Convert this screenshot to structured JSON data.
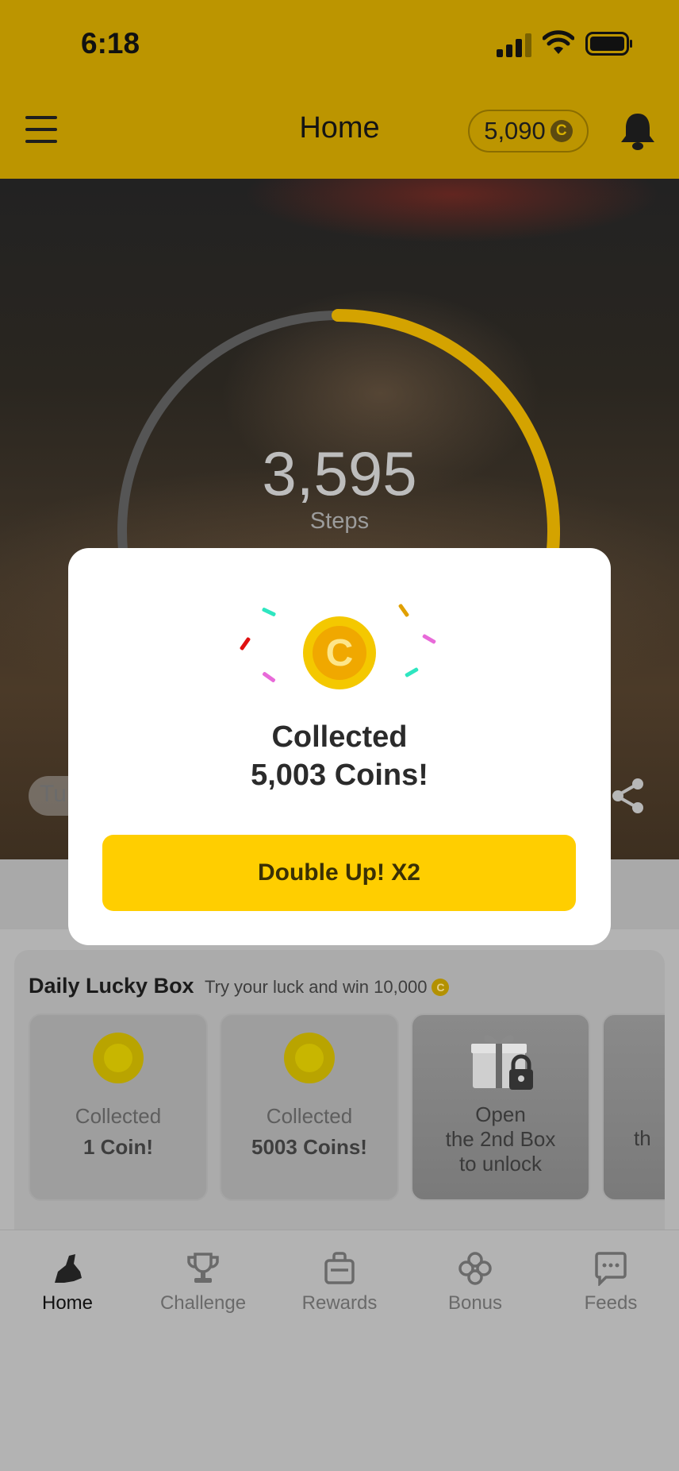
{
  "status_bar": {
    "time": "6:18"
  },
  "header": {
    "title": "Home",
    "coin_balance": "5,090",
    "coin_glyph": "C"
  },
  "hero": {
    "steps_value": "3,595",
    "steps_label": "Steps",
    "step_goal_progress": 0.45,
    "chip_text": "Tu"
  },
  "lucky_box": {
    "title": "Daily Lucky Box",
    "subtitle": "Try your luck and win 10,000",
    "boxes": [
      {
        "line1": "Collected",
        "line2": "1 Coin!"
      },
      {
        "line1": "Collected",
        "line2": "5003 Coins!"
      },
      {
        "line1": "Open",
        "line2": "the 2nd Box",
        "line3": "to unlock"
      },
      {
        "line1": "",
        "line2": "th",
        "line3": "t"
      }
    ]
  },
  "nav": {
    "items": [
      {
        "label": "Home",
        "icon": "shoe-icon",
        "active": true
      },
      {
        "label": "Challenge",
        "icon": "trophy-icon",
        "active": false
      },
      {
        "label": "Rewards",
        "icon": "shopping-bag-icon",
        "active": false
      },
      {
        "label": "Bonus",
        "icon": "clover-icon",
        "active": false
      },
      {
        "label": "Feeds",
        "icon": "chat-bubble-icon",
        "active": false
      }
    ]
  },
  "modal": {
    "title_line1": "Collected",
    "title_line2": "5,003 Coins!",
    "coin_glyph": "C",
    "button_label": "Double Up! X2"
  },
  "colors": {
    "accent_yellow": "#ffce00",
    "header_gold": "#bc9500",
    "ring_progress": "#d4a300"
  }
}
